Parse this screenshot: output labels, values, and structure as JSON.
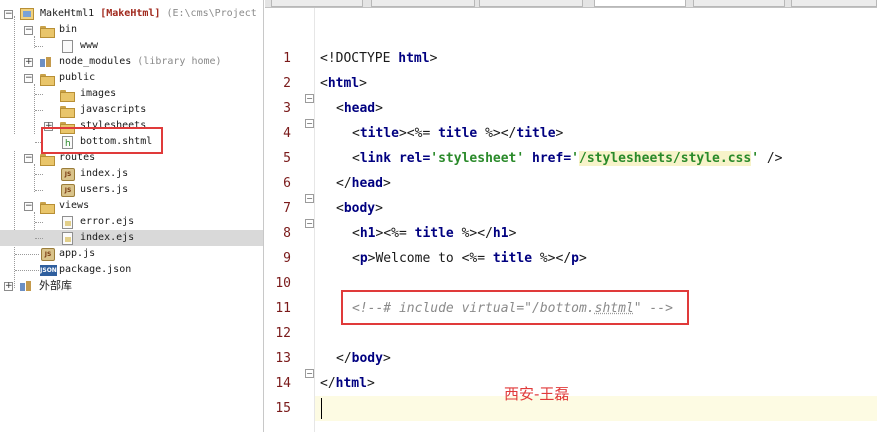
{
  "tree": {
    "project": {
      "name": "MakeHtml1",
      "module": "[MakeHtml]",
      "path": "(E:\\cms\\Project"
    },
    "items": [
      {
        "label": "bin"
      },
      {
        "label": "www"
      },
      {
        "label": "node_modules",
        "note": "(library home)"
      },
      {
        "label": "public"
      },
      {
        "label": "images"
      },
      {
        "label": "javascripts"
      },
      {
        "label": "stylesheets"
      },
      {
        "label": "bottom.shtml"
      },
      {
        "label": "routes"
      },
      {
        "label": "index.js"
      },
      {
        "label": "users.js"
      },
      {
        "label": "views"
      },
      {
        "label": "error.ejs"
      },
      {
        "label": "index.ejs"
      },
      {
        "label": "app.js"
      },
      {
        "label": "package.json"
      },
      {
        "label": "外部库"
      }
    ],
    "selected_item": "index.ejs",
    "js_icon_text": "JS",
    "json_icon_text": "JSON"
  },
  "editor": {
    "line_numbers": [
      "1",
      "2",
      "3",
      "4",
      "5",
      "6",
      "7",
      "8",
      "9",
      "10",
      "11",
      "12",
      "13",
      "14",
      "15"
    ],
    "code": {
      "l1_a": "<!DOCTYPE ",
      "l1_b": "html",
      "l1_c": ">",
      "l2_a": "<",
      "l2_b": "html",
      "l2_c": ">",
      "l3_a": "<",
      "l3_b": "head",
      "l3_c": ">",
      "l4_a": "<",
      "l4_b": "title",
      "l4_c": ">",
      "l4_d": "<%= ",
      "l4_e": "title",
      "l4_f": " %>",
      "l4_g": "</",
      "l4_h": "title",
      "l4_i": ">",
      "l5_a": "<",
      "l5_b": "link ",
      "l5_c": "rel=",
      "l5_d": "'stylesheet'",
      "l5_e": " href=",
      "l5_f": "'",
      "l5_g": "/stylesheets/style.css",
      "l5_h": "'",
      "l5_i": " />",
      "l6_a": "</",
      "l6_b": "head",
      "l6_c": ">",
      "l7_a": "<",
      "l7_b": "body",
      "l7_c": ">",
      "l8_a": "<",
      "l8_b": "h1",
      "l8_c": ">",
      "l8_d": "<%= ",
      "l8_e": "title",
      "l8_f": " %>",
      "l8_g": "</",
      "l8_h": "h1",
      "l8_i": ">",
      "l9_a": "<",
      "l9_b": "p",
      "l9_c": ">",
      "l9_d": "Welcome to ",
      "l9_e": "<%= ",
      "l9_f": "title",
      "l9_g": " %>",
      "l9_h": "</",
      "l9_i": "p",
      "l9_j": ">",
      "l11_a": "<!--# include virtual=\"/bottom.",
      "l11_b": "shtml",
      "l11_c": "\" -->",
      "l13_a": "</",
      "l13_b": "body",
      "l13_c": ">",
      "l14_a": "</",
      "l14_b": "html",
      "l14_c": ">"
    }
  },
  "watermark": "西安-王磊",
  "colors": {
    "annotation_red": "#e03a3a",
    "tag_blue": "#000080",
    "string_green": "#2a8a2a",
    "line_number": "#7a1a1a"
  }
}
